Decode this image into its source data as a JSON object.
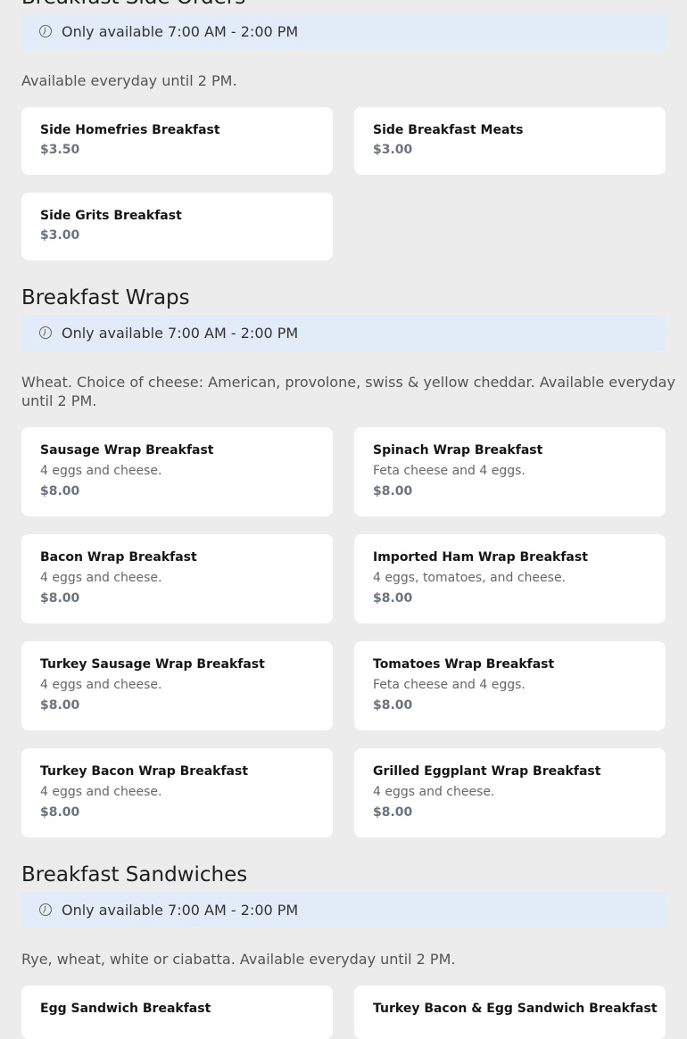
{
  "sections": {
    "side_orders": {
      "title": "Breakfast Side Orders",
      "availability": "Only available 7:00 AM - 2:00 PM",
      "description": "Available everyday until 2 PM.",
      "items": [
        {
          "name": "Side Homefries Breakfast",
          "price": "$3.50"
        },
        {
          "name": "Side Breakfast Meats",
          "price": "$3.00"
        },
        {
          "name": "Side Grits Breakfast",
          "price": "$3.00"
        }
      ]
    },
    "wraps": {
      "title": "Breakfast Wraps",
      "availability": "Only available 7:00 AM - 2:00 PM",
      "description": "Wheat. Choice of cheese: American, provolone, swiss & yellow cheddar. Available everyday until 2 PM.",
      "items": [
        {
          "name": "Sausage Wrap Breakfast",
          "desc": "4 eggs and cheese.",
          "price": "$8.00"
        },
        {
          "name": "Spinach Wrap Breakfast",
          "desc": "Feta cheese and 4 eggs.",
          "price": "$8.00"
        },
        {
          "name": "Bacon Wrap Breakfast",
          "desc": "4 eggs and cheese.",
          "price": "$8.00"
        },
        {
          "name": "Imported Ham Wrap Breakfast",
          "desc": "4 eggs, tomatoes, and cheese.",
          "price": "$8.00"
        },
        {
          "name": "Turkey Sausage Wrap Breakfast",
          "desc": "4 eggs and cheese.",
          "price": "$8.00"
        },
        {
          "name": "Tomatoes Wrap Breakfast",
          "desc": "Feta cheese and 4 eggs.",
          "price": "$8.00"
        },
        {
          "name": "Turkey Bacon Wrap Breakfast",
          "desc": "4 eggs and cheese.",
          "price": "$8.00"
        },
        {
          "name": "Grilled Eggplant Wrap Breakfast",
          "desc": "4 eggs and cheese.",
          "price": "$8.00"
        }
      ]
    },
    "sandwiches": {
      "title": "Breakfast Sandwiches",
      "availability": "Only available 7:00 AM - 2:00 PM",
      "description": "Rye, wheat, white or ciabatta. Available everyday until 2 PM.",
      "items": [
        {
          "name": "Egg Sandwich Breakfast"
        },
        {
          "name": "Turkey Bacon & Egg Sandwich Breakfast"
        }
      ]
    }
  },
  "icons": {
    "availability": "clock-icon"
  },
  "colors": {
    "background": "#ececec",
    "availability_bar": "#e2ecf8",
    "price": "#6b7380",
    "card": "#ffffff"
  }
}
